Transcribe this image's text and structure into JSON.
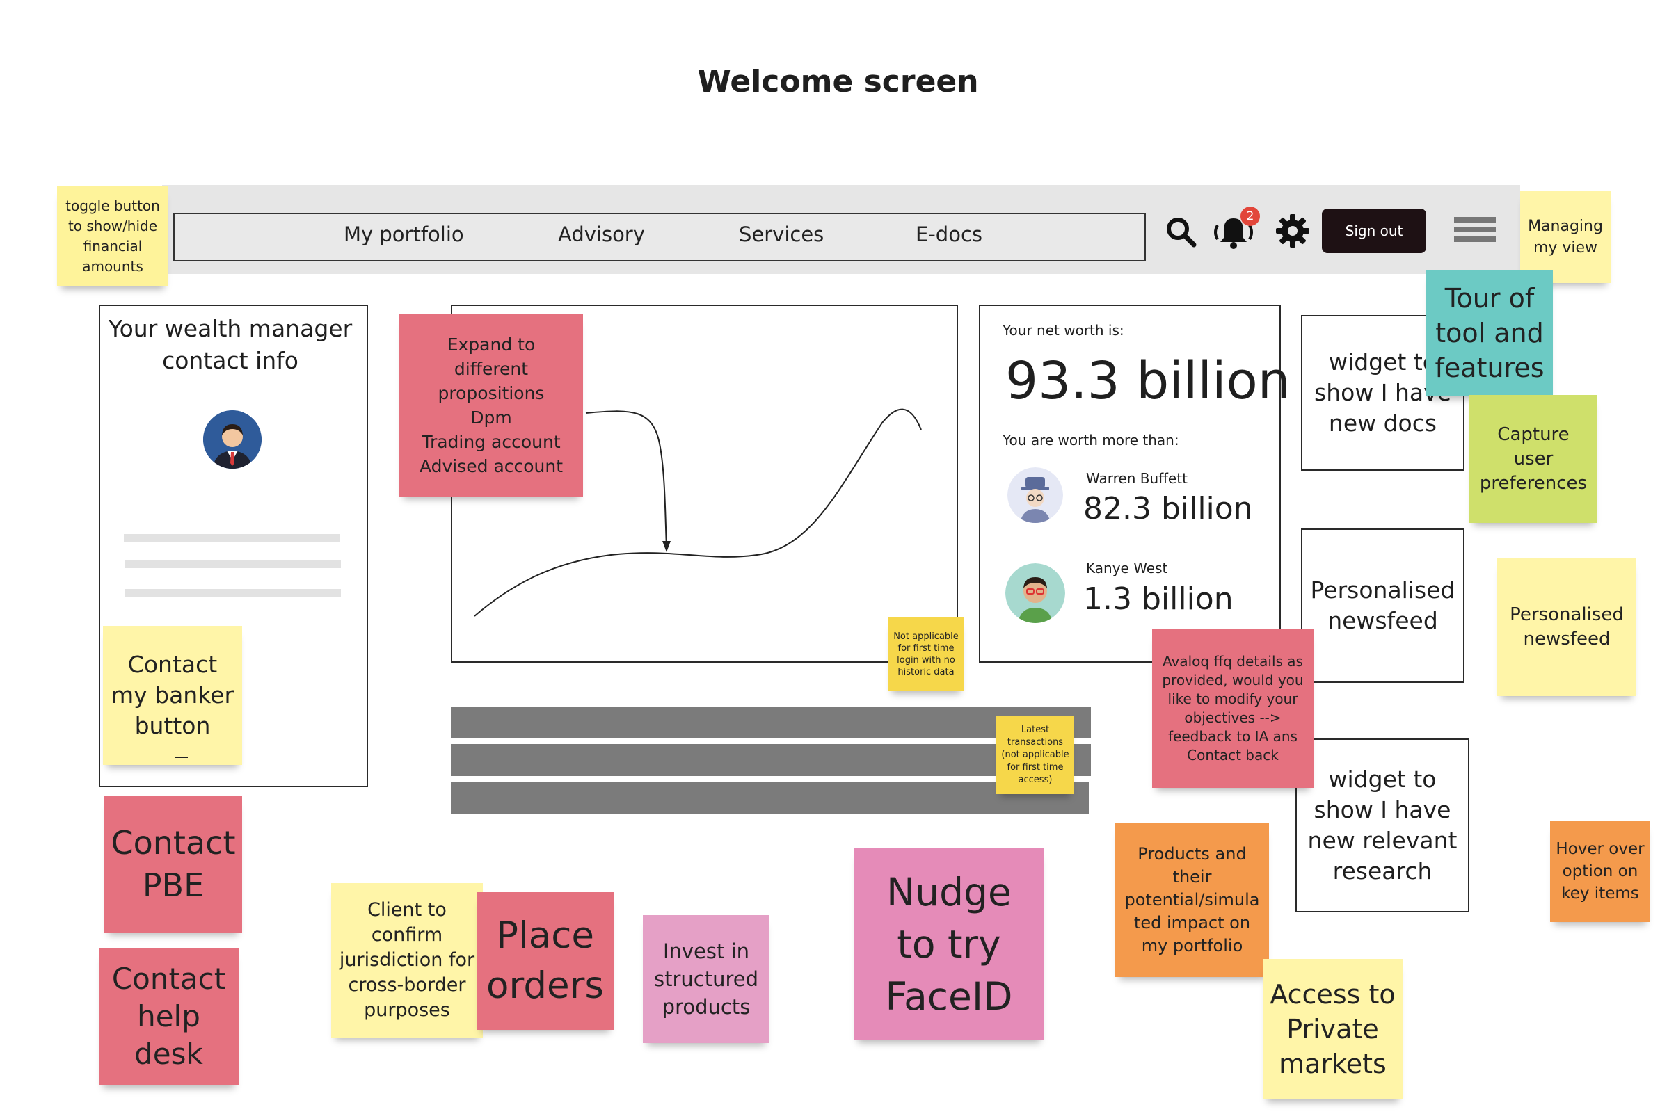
{
  "page_title": "Welcome screen",
  "nav": {
    "items": [
      "My portfolio",
      "Advisory",
      "Services",
      "E-docs"
    ],
    "notification_count": "2",
    "sign_out_label": "Sign out",
    "icons": [
      "search-icon",
      "bell-icon",
      "gear-icon",
      "hamburger-menu-icon"
    ]
  },
  "wealth_manager": {
    "title": "Your wealth manager contact info"
  },
  "net_worth": {
    "label": "Your net worth is:",
    "value": "93.3 billion",
    "compare_label": "You are worth more than:",
    "people": [
      {
        "name": "Warren Buffett",
        "value": "82.3 billion"
      },
      {
        "name": "Kanye West",
        "value": "1.3 billion"
      }
    ]
  },
  "widgets": {
    "new_docs": "widget to show I have new docs",
    "newsfeed": "Personalised newsfeed",
    "research": "widget to show I have new relevant research"
  },
  "stickies": {
    "toggle": "toggle button\nto show/hide\nfinancial\namounts",
    "managing": "Managing\nmy view",
    "tour": "Tour of\ntool and\nfeatures",
    "capture": "Capture\nuser\npreferences",
    "newsfeed": "Personalised\nnewsfeed",
    "expand": "Expand to\ndifferent\npropositions\nDpm\nTrading account\nAdvised account",
    "contact_banker": "Contact\nmy banker\nbutton",
    "not_applicable": "Not applicable\nfor first time\nlogin with no\nhistoric data",
    "latest_tx": "Latest\ntransactions\n(not applicable\nfor first time\naccess)",
    "avaloq": "Avaloq ffq details as\nprovided, would you\nlike to modify your\nobjectives -->\nfeedback to IA ans\nContact back",
    "contact_pbe": "Contact\nPBE",
    "contact_help": "Contact\nhelp\ndesk",
    "jurisdiction": "Client to\nconfirm\njurisdiction for\ncross-border\npurposes",
    "place_orders": "Place\norders",
    "invest": "Invest in\nstructured\nproducts",
    "faceid": "Nudge\nto try\nFaceID",
    "products": "Products and\ntheir\npotential/simula\nted impact on\nmy portfolio",
    "private": "Access to\nPrivate\nmarkets",
    "hover": "Hover over\noption on\nkey items"
  }
}
